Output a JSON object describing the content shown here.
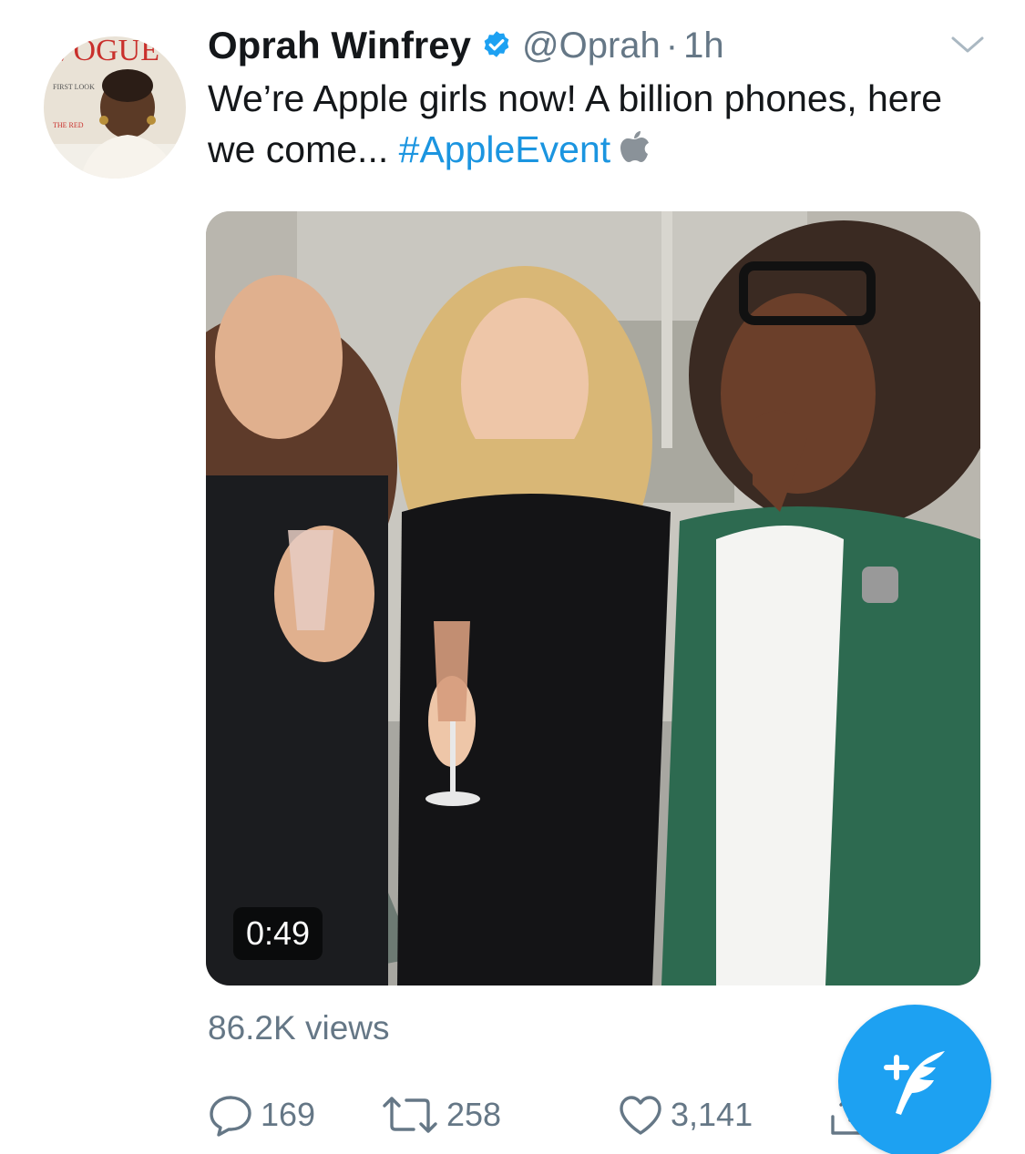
{
  "tweet": {
    "author_name": "Oprah Winfrey",
    "handle": "@Oprah",
    "separator": "·",
    "timestamp": "1h",
    "text": "We’re Apple girls now! A billion phones, here we come...",
    "hashtag": "#AppleEvent",
    "avatar_magazine_title": "VOGUE"
  },
  "media": {
    "duration": "0:49"
  },
  "stats": {
    "views": "86.2K views"
  },
  "actions": {
    "reply_count": "169",
    "retweet_count": "258",
    "like_count": "3,141"
  },
  "icons": {
    "verified": "verified-badge-icon",
    "caret": "chevron-down-icon",
    "apple": "apple-logo-icon",
    "reply": "reply-icon",
    "retweet": "retweet-icon",
    "like": "heart-icon",
    "share": "share-icon",
    "compose": "compose-tweet-icon"
  },
  "colors": {
    "link_blue": "#1b95e0",
    "fab_blue": "#1da1f2",
    "muted_gray": "#657786",
    "text_dark": "#14171a"
  }
}
